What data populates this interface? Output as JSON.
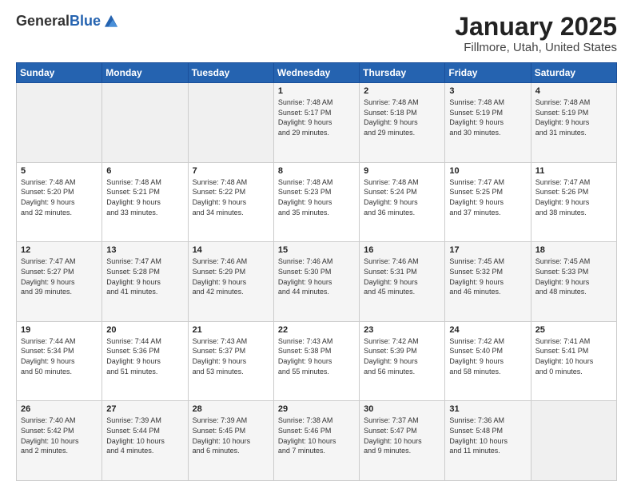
{
  "logo": {
    "general": "General",
    "blue": "Blue"
  },
  "header": {
    "title": "January 2025",
    "subtitle": "Fillmore, Utah, United States"
  },
  "days_of_week": [
    "Sunday",
    "Monday",
    "Tuesday",
    "Wednesday",
    "Thursday",
    "Friday",
    "Saturday"
  ],
  "weeks": [
    [
      {
        "day": "",
        "info": ""
      },
      {
        "day": "",
        "info": ""
      },
      {
        "day": "",
        "info": ""
      },
      {
        "day": "1",
        "info": "Sunrise: 7:48 AM\nSunset: 5:17 PM\nDaylight: 9 hours\nand 29 minutes."
      },
      {
        "day": "2",
        "info": "Sunrise: 7:48 AM\nSunset: 5:18 PM\nDaylight: 9 hours\nand 29 minutes."
      },
      {
        "day": "3",
        "info": "Sunrise: 7:48 AM\nSunset: 5:19 PM\nDaylight: 9 hours\nand 30 minutes."
      },
      {
        "day": "4",
        "info": "Sunrise: 7:48 AM\nSunset: 5:19 PM\nDaylight: 9 hours\nand 31 minutes."
      }
    ],
    [
      {
        "day": "5",
        "info": "Sunrise: 7:48 AM\nSunset: 5:20 PM\nDaylight: 9 hours\nand 32 minutes."
      },
      {
        "day": "6",
        "info": "Sunrise: 7:48 AM\nSunset: 5:21 PM\nDaylight: 9 hours\nand 33 minutes."
      },
      {
        "day": "7",
        "info": "Sunrise: 7:48 AM\nSunset: 5:22 PM\nDaylight: 9 hours\nand 34 minutes."
      },
      {
        "day": "8",
        "info": "Sunrise: 7:48 AM\nSunset: 5:23 PM\nDaylight: 9 hours\nand 35 minutes."
      },
      {
        "day": "9",
        "info": "Sunrise: 7:48 AM\nSunset: 5:24 PM\nDaylight: 9 hours\nand 36 minutes."
      },
      {
        "day": "10",
        "info": "Sunrise: 7:47 AM\nSunset: 5:25 PM\nDaylight: 9 hours\nand 37 minutes."
      },
      {
        "day": "11",
        "info": "Sunrise: 7:47 AM\nSunset: 5:26 PM\nDaylight: 9 hours\nand 38 minutes."
      }
    ],
    [
      {
        "day": "12",
        "info": "Sunrise: 7:47 AM\nSunset: 5:27 PM\nDaylight: 9 hours\nand 39 minutes."
      },
      {
        "day": "13",
        "info": "Sunrise: 7:47 AM\nSunset: 5:28 PM\nDaylight: 9 hours\nand 41 minutes."
      },
      {
        "day": "14",
        "info": "Sunrise: 7:46 AM\nSunset: 5:29 PM\nDaylight: 9 hours\nand 42 minutes."
      },
      {
        "day": "15",
        "info": "Sunrise: 7:46 AM\nSunset: 5:30 PM\nDaylight: 9 hours\nand 44 minutes."
      },
      {
        "day": "16",
        "info": "Sunrise: 7:46 AM\nSunset: 5:31 PM\nDaylight: 9 hours\nand 45 minutes."
      },
      {
        "day": "17",
        "info": "Sunrise: 7:45 AM\nSunset: 5:32 PM\nDaylight: 9 hours\nand 46 minutes."
      },
      {
        "day": "18",
        "info": "Sunrise: 7:45 AM\nSunset: 5:33 PM\nDaylight: 9 hours\nand 48 minutes."
      }
    ],
    [
      {
        "day": "19",
        "info": "Sunrise: 7:44 AM\nSunset: 5:34 PM\nDaylight: 9 hours\nand 50 minutes."
      },
      {
        "day": "20",
        "info": "Sunrise: 7:44 AM\nSunset: 5:36 PM\nDaylight: 9 hours\nand 51 minutes."
      },
      {
        "day": "21",
        "info": "Sunrise: 7:43 AM\nSunset: 5:37 PM\nDaylight: 9 hours\nand 53 minutes."
      },
      {
        "day": "22",
        "info": "Sunrise: 7:43 AM\nSunset: 5:38 PM\nDaylight: 9 hours\nand 55 minutes."
      },
      {
        "day": "23",
        "info": "Sunrise: 7:42 AM\nSunset: 5:39 PM\nDaylight: 9 hours\nand 56 minutes."
      },
      {
        "day": "24",
        "info": "Sunrise: 7:42 AM\nSunset: 5:40 PM\nDaylight: 9 hours\nand 58 minutes."
      },
      {
        "day": "25",
        "info": "Sunrise: 7:41 AM\nSunset: 5:41 PM\nDaylight: 10 hours\nand 0 minutes."
      }
    ],
    [
      {
        "day": "26",
        "info": "Sunrise: 7:40 AM\nSunset: 5:42 PM\nDaylight: 10 hours\nand 2 minutes."
      },
      {
        "day": "27",
        "info": "Sunrise: 7:39 AM\nSunset: 5:44 PM\nDaylight: 10 hours\nand 4 minutes."
      },
      {
        "day": "28",
        "info": "Sunrise: 7:39 AM\nSunset: 5:45 PM\nDaylight: 10 hours\nand 6 minutes."
      },
      {
        "day": "29",
        "info": "Sunrise: 7:38 AM\nSunset: 5:46 PM\nDaylight: 10 hours\nand 7 minutes."
      },
      {
        "day": "30",
        "info": "Sunrise: 7:37 AM\nSunset: 5:47 PM\nDaylight: 10 hours\nand 9 minutes."
      },
      {
        "day": "31",
        "info": "Sunrise: 7:36 AM\nSunset: 5:48 PM\nDaylight: 10 hours\nand 11 minutes."
      },
      {
        "day": "",
        "info": ""
      }
    ]
  ]
}
